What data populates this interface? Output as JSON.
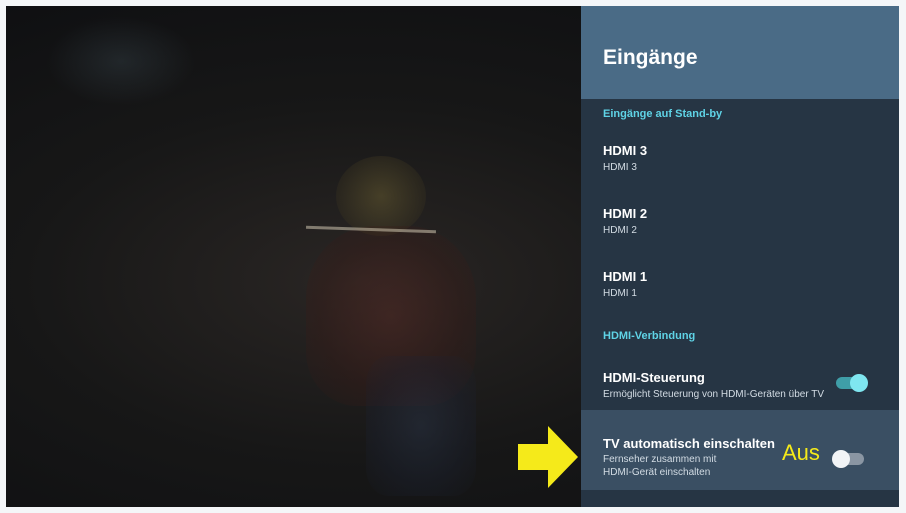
{
  "panel": {
    "title": "Eingänge",
    "sections": {
      "standby_label": "Eingänge auf Stand-by",
      "hdmi_link_label": "HDMI-Verbindung"
    },
    "inputs": [
      {
        "title": "HDMI 3",
        "subtitle": "HDMI 3"
      },
      {
        "title": "HDMI 2",
        "subtitle": "HDMI 2"
      },
      {
        "title": "HDMI 1",
        "subtitle": "HDMI 1"
      }
    ],
    "hdmi_control": {
      "title": "HDMI-Steuerung",
      "subtitle": "Ermöglicht Steuerung von HDMI-Geräten über TV",
      "enabled": true
    },
    "auto_power": {
      "title": "TV automatisch einschalten",
      "subtitle": "Fernseher zusammen mit HDMI-Gerät einschalten",
      "enabled": false
    }
  },
  "annotation": {
    "label": "Aus",
    "arrow_color": "#f5ea1a"
  },
  "colors": {
    "header_bg": "#4a6b86",
    "panel_bg": "#263544",
    "section_accent": "#5fd3e6",
    "toggle_on": "#7fe6f0"
  }
}
